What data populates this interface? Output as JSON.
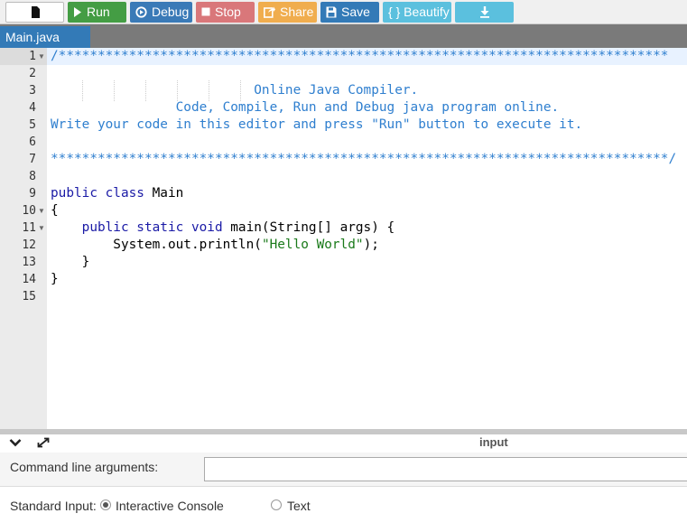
{
  "toolbar": {
    "run_label": "Run",
    "debug_label": "Debug",
    "stop_label": "Stop",
    "share_label": "Share",
    "save_label": "Save",
    "beautify_label": "{ } Beautify"
  },
  "tabs": {
    "active": "Main.java"
  },
  "editor": {
    "line_numbers": [
      "1",
      "2",
      "3",
      "4",
      "5",
      "6",
      "7",
      "8",
      "9",
      "10",
      "11",
      "12",
      "13",
      "14",
      "15"
    ],
    "lines": {
      "l1": "/******************************************************************************",
      "l3": "                          Online Java Compiler.",
      "l4": "                Code, Compile, Run and Debug java program online.",
      "l5": "Write your code in this editor and press \"Run\" button to execute it.",
      "l7": "*******************************************************************************/",
      "l9_kw": "public class",
      "l9_rest": " Main",
      "l10": "{",
      "l11_kw": "    public static void",
      "l11_rest": " main(String[] args) {",
      "l12_a": "        System.out.println(",
      "l12_str": "\"Hello World\"",
      "l12_b": ");",
      "l13": "    }",
      "l14": "}"
    }
  },
  "io_panel": {
    "title": "input",
    "cmd_label": "Command line arguments:",
    "cmd_value": "",
    "stdin_label": "Standard Input:",
    "option_interactive": "Interactive Console",
    "option_text": "Text",
    "selected": "Interactive Console"
  },
  "colors": {
    "run": "#449d44",
    "debug": "#3a7ab7",
    "stop": "#d9777a",
    "share": "#f0ad4e",
    "save": "#337ab7",
    "beautify": "#5bc0de",
    "tab_active": "#337ab7",
    "comment": "#2f7fcf"
  },
  "icons": [
    "file-icon",
    "play-icon",
    "debug-icon",
    "stop-icon",
    "share-icon",
    "save-icon",
    "download-icon",
    "collapse-icon",
    "expand-icon"
  ]
}
